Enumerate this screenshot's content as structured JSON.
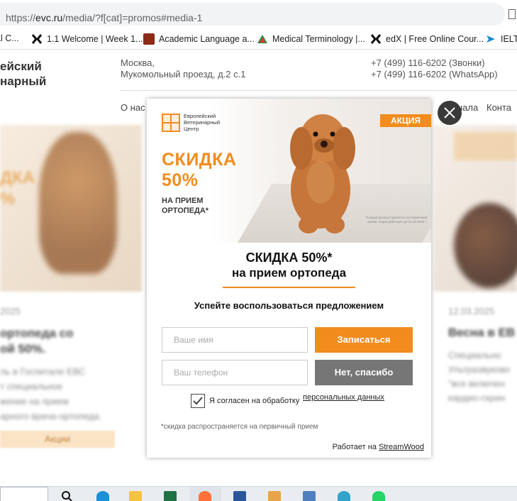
{
  "browser": {
    "url_prefix": "https://",
    "url_domain": "evc.ru",
    "url_rest": "/media/?f[cat]=promos#media-1"
  },
  "bookmarks": [
    {
      "label": "al C...",
      "icon": "generic-icon",
      "color": "#888888"
    },
    {
      "label": "1.1 Welcome | Week 1...",
      "icon": "x-icon",
      "color": "#111111"
    },
    {
      "label": "Academic Language a...",
      "icon": "academic-icon",
      "color": "#8b2b18"
    },
    {
      "label": "Medical Terminology |...",
      "icon": "triangle-icon",
      "color": "#2a8b3a"
    },
    {
      "label": "edX | Free Online Cour...",
      "icon": "x-icon",
      "color": "#111111"
    },
    {
      "label": "IELTS",
      "icon": "arrow-icon",
      "color": "#1a8ad4"
    }
  ],
  "site": {
    "brand_line1": "ейский",
    "brand_line2": "нарный",
    "address_line1": "Москва,",
    "address_line2": "Мукомольный проезд, д.2 с.1",
    "phone_calls": "+7 (499) 116-6202 (Звонки)",
    "phone_whatsapp": "+7 (499) 116-6202 (WhatsApp)",
    "nav_left": "О нас",
    "nav_mid": "нала",
    "nav_right": "Конта",
    "left_card": {
      "promo_line1": "ДКА",
      "promo_line2": "%",
      "date": "2025",
      "title_line1": "ортопеда со",
      "title_line2": "ой 50%.",
      "desc_line1": "ль в Госпитале ЕВС",
      "desc_line2": "т специальное",
      "desc_line3": "жение на прием",
      "desc_line4": "арного врача-ортопеда.",
      "tag": "Акции"
    },
    "right_card": {
      "date": "12.03.2025",
      "title": "Весна в ЕВ",
      "desc_line1": "Специально",
      "desc_line2": "Ультразвуково",
      "desc_line3": "\"все включен",
      "desc_line4": "кардио-скрин"
    }
  },
  "modal": {
    "logo_line1": "Европейский",
    "logo_line2": "Ветеринарный",
    "logo_line3": "Центр",
    "badge": "АКЦИЯ",
    "promo_line1": "СКИДКА",
    "promo_line2": "50%",
    "promo_sub1": "НА ПРИЕМ",
    "promo_sub2": "ОРТОПЕДА*",
    "banner_footnote": "*Скидка распространяется на первичный прием. Акция действует до 31.03.2025 г.",
    "headline1": "СКИДКА 50%*",
    "headline2": "на прием ортопеда",
    "subheadline": "Успейте воспользоваться предложением",
    "name_placeholder": "Ваше имя",
    "phone_placeholder": "Ваш телефон",
    "submit_label": "Записаться",
    "decline_label": "Нет, спасибо",
    "consent_text": "Я согласен на обработку",
    "consent_link": "персональных данных",
    "consent_checked": true,
    "note": "*скидка распространяется на первичный прием",
    "powered_prefix": "Работает на",
    "powered_link": "StreamWood"
  },
  "colors": {
    "accent": "#f28c1c",
    "decline": "#767676",
    "close": "#3a3a3a"
  },
  "taskbar": {
    "apps": [
      "search-icon",
      "edge-icon",
      "file-explorer-icon",
      "excel-icon",
      "firefox-icon",
      "word-icon",
      "media-icon",
      "app-icon",
      "edge-chromium-icon",
      "whatsapp-icon"
    ]
  }
}
